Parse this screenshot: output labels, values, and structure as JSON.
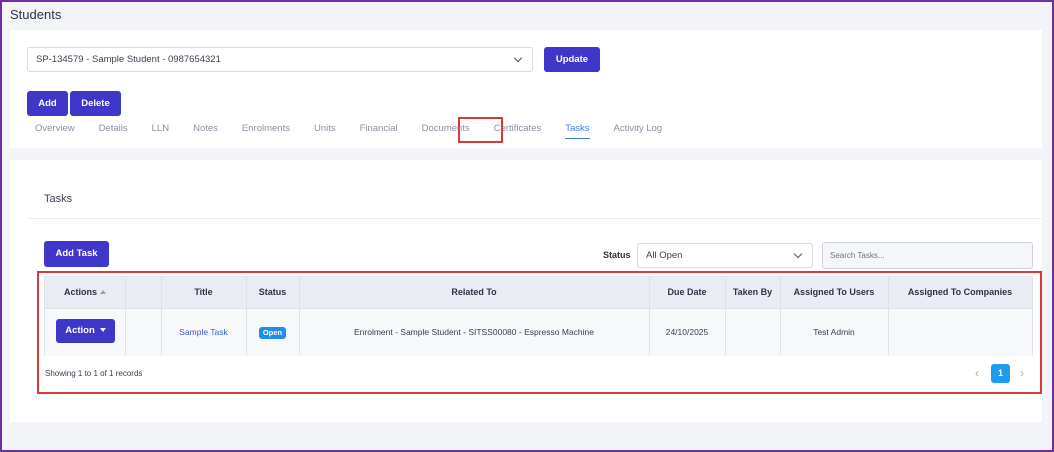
{
  "page": {
    "title": "Students"
  },
  "student_selector": {
    "value": "SP-134579 - Sample Student - 0987654321"
  },
  "buttons": {
    "update": "Update",
    "add": "Add",
    "delete": "Delete",
    "add_task": "Add Task",
    "action": "Action"
  },
  "tabs": [
    {
      "label": "Overview",
      "active": false
    },
    {
      "label": "Details",
      "active": false
    },
    {
      "label": "LLN",
      "active": false
    },
    {
      "label": "Notes",
      "active": false
    },
    {
      "label": "Enrolments",
      "active": false
    },
    {
      "label": "Units",
      "active": false
    },
    {
      "label": "Financial",
      "active": false
    },
    {
      "label": "Documents",
      "active": false
    },
    {
      "label": "Certificates",
      "active": false
    },
    {
      "label": "Tasks",
      "active": true
    },
    {
      "label": "Activity Log",
      "active": false
    }
  ],
  "tasks": {
    "heading": "Tasks",
    "status_label": "Status",
    "status_value": "All Open",
    "search_placeholder": "Search Tasks...",
    "columns": [
      "Actions",
      "Title",
      "Status",
      "Related To",
      "Due Date",
      "Taken By",
      "Assigned To Users",
      "Assigned To Companies"
    ],
    "rows": [
      {
        "title": "Sample Task",
        "status": "Open",
        "related_to": "Enrolment - Sample Student - SITSS00080 - Espresso Machine",
        "due_date": "24/10/2025",
        "taken_by": "",
        "assigned_users": "Test Admin",
        "assigned_companies": ""
      }
    ],
    "records_text": "Showing 1 to 1 of 1 records",
    "pagination": {
      "current_page": "1",
      "prev_symbol": "‹",
      "next_symbol": "›"
    }
  },
  "colors": {
    "primary": "#3f37c9",
    "highlight": "#d83a3a",
    "badge": "#1c8ff0",
    "frame": "#6b2fa8"
  }
}
